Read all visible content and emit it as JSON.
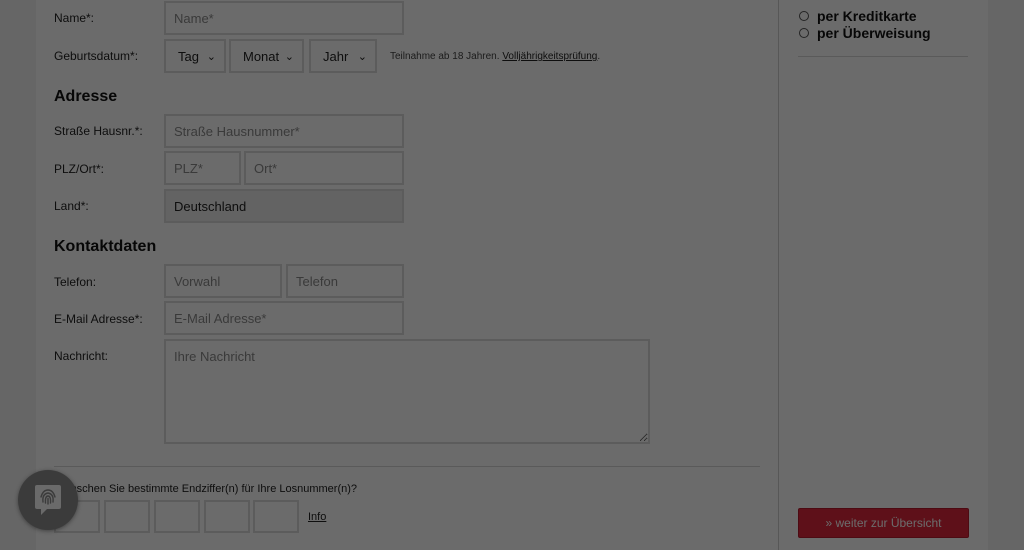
{
  "form": {
    "name": {
      "label": "Name*:",
      "placeholder": "Name*"
    },
    "birthdate": {
      "label": "Geburtsdatum*:",
      "day": "Tag",
      "month": "Monat",
      "year": "Jahr",
      "note": "Teilnahme ab 18 Jahren.",
      "note_link": "Volljährigkeitsprüfung",
      "note_suffix": "."
    },
    "address": {
      "title": "Adresse",
      "street": {
        "label": "Straße Hausnr.*:",
        "placeholder": "Straße Hausnummer*"
      },
      "plz_ort": {
        "label": "PLZ/Ort*:",
        "plz_placeholder": "PLZ*",
        "ort_placeholder": "Ort*"
      },
      "country": {
        "label": "Land*:",
        "value": "Deutschland"
      }
    },
    "contact": {
      "title": "Kontaktdaten",
      "phone": {
        "label": "Telefon:",
        "area_placeholder": "Vorwahl",
        "number_placeholder": "Telefon"
      },
      "email": {
        "label": "E-Mail Adresse*:",
        "placeholder": "E-Mail Adresse*"
      },
      "message": {
        "label": "Nachricht:",
        "placeholder": "Ihre Nachricht"
      }
    },
    "lottery": {
      "question": "Wünschen Sie bestimmte Endziffer(n) für Ihre Losnummer(n)?",
      "info_link": "Info"
    }
  },
  "sidebar": {
    "payment_options": [
      "per Kreditkarte",
      "per Überweisung"
    ],
    "continue_button": "» weiter zur Übersicht"
  },
  "icons": {
    "fingerprint": "fingerprint-icon"
  }
}
